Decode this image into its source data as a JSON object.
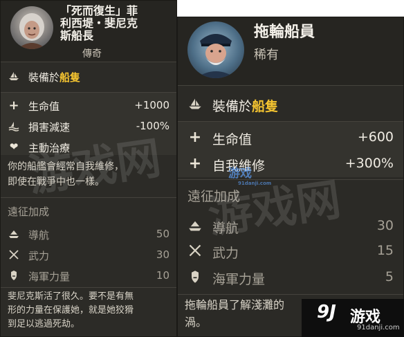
{
  "card_a": {
    "name": "「死而復生」菲利西堤・斐尼克斯船長",
    "name_lines": [
      "「死而復生」菲",
      "利西堤・斐尼克",
      "斯船長"
    ],
    "rarity": "傳奇",
    "equip_prefix": "裝備於",
    "equip_target": "船隻",
    "stats": [
      {
        "icon": "plus-icon",
        "label": "生命值",
        "value": "+1000"
      },
      {
        "icon": "ship-wave-icon",
        "label": "損害減速",
        "value": "-100%"
      },
      {
        "icon": "heart-icon",
        "label": "主動治療",
        "value": ""
      }
    ],
    "ability_desc_lines": [
      "你的船艦會經常自我維修，",
      "即使在戰爭中也一樣。"
    ],
    "expedition_header": "遠征加成",
    "expedition": [
      {
        "icon": "compass-ship-icon",
        "label": "導航",
        "value": "50"
      },
      {
        "icon": "crossed-swords-icon",
        "label": "武力",
        "value": "30"
      },
      {
        "icon": "naval-power-icon",
        "label": "海軍力量",
        "value": "10"
      }
    ],
    "lore_lines": [
      "斐尼克斯活了很久。要不是有無",
      "形的力量在保護她，就是她狡猾",
      "到足以逃過死劫。"
    ]
  },
  "card_b": {
    "name": "拖輪船員",
    "rarity": "稀有",
    "equip_prefix": "裝備於",
    "equip_target": "船隻",
    "stats": [
      {
        "icon": "plus-icon",
        "label": "生命值",
        "value": "+600"
      },
      {
        "icon": "plus-icon",
        "label": "自我維修",
        "value": "+300%"
      }
    ],
    "expedition_header": "遠征加成",
    "expedition": [
      {
        "icon": "compass-ship-icon",
        "label": "導航",
        "value": "30"
      },
      {
        "icon": "crossed-swords-icon",
        "label": "武力",
        "value": "15"
      },
      {
        "icon": "naval-power-icon",
        "label": "海軍力量",
        "value": "5"
      }
    ],
    "lore_lines": [
      "拖輪船員了解淺灘的",
      "渦。"
    ]
  },
  "watermark": {
    "logo_mark": "9J",
    "logo_text": "游戏",
    "logo_site": "91danji.com",
    "faint_text": "游戏网"
  }
}
